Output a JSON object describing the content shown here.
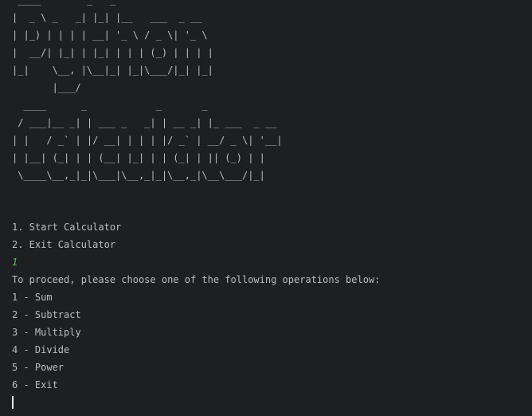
{
  "ascii_art": {
    "python": " ____        _   _\n|  _ \\ _   _| |_| |__   ___  _ __\n| |_) | | | | __| '_ \\ / _ \\| '_ \\\n|  __/| |_| | |_| | | | (_) | | | |\n|_|    \\__, |\\__|_| |_|\\___/|_| |_|\n       |___/",
    "calculator": "  ____      _            _       _\n / ___|__ _| | ___ _   _| | __ _| |_ ___  _ __\n| |   / _` | |/ __| | | | |/ _` | __/ _ \\| '__|\n| |__| (_| | | (__| |_| | | (_| | || (_) | |\n \\____\\__,_|_|\\___|\\__,_|_|\\__,_|\\__\\___/|_|"
  },
  "menu": {
    "start": "1. Start Calculator",
    "exit": "2. Exit Calculator"
  },
  "user_choice": "1",
  "prompt": "To proceed, please choose one of the following operations below:",
  "operations": [
    "1 - Sum",
    "2 - Subtract",
    "3 - Multiply",
    "4 - Divide",
    "5 - Power",
    "6 - Exit"
  ]
}
